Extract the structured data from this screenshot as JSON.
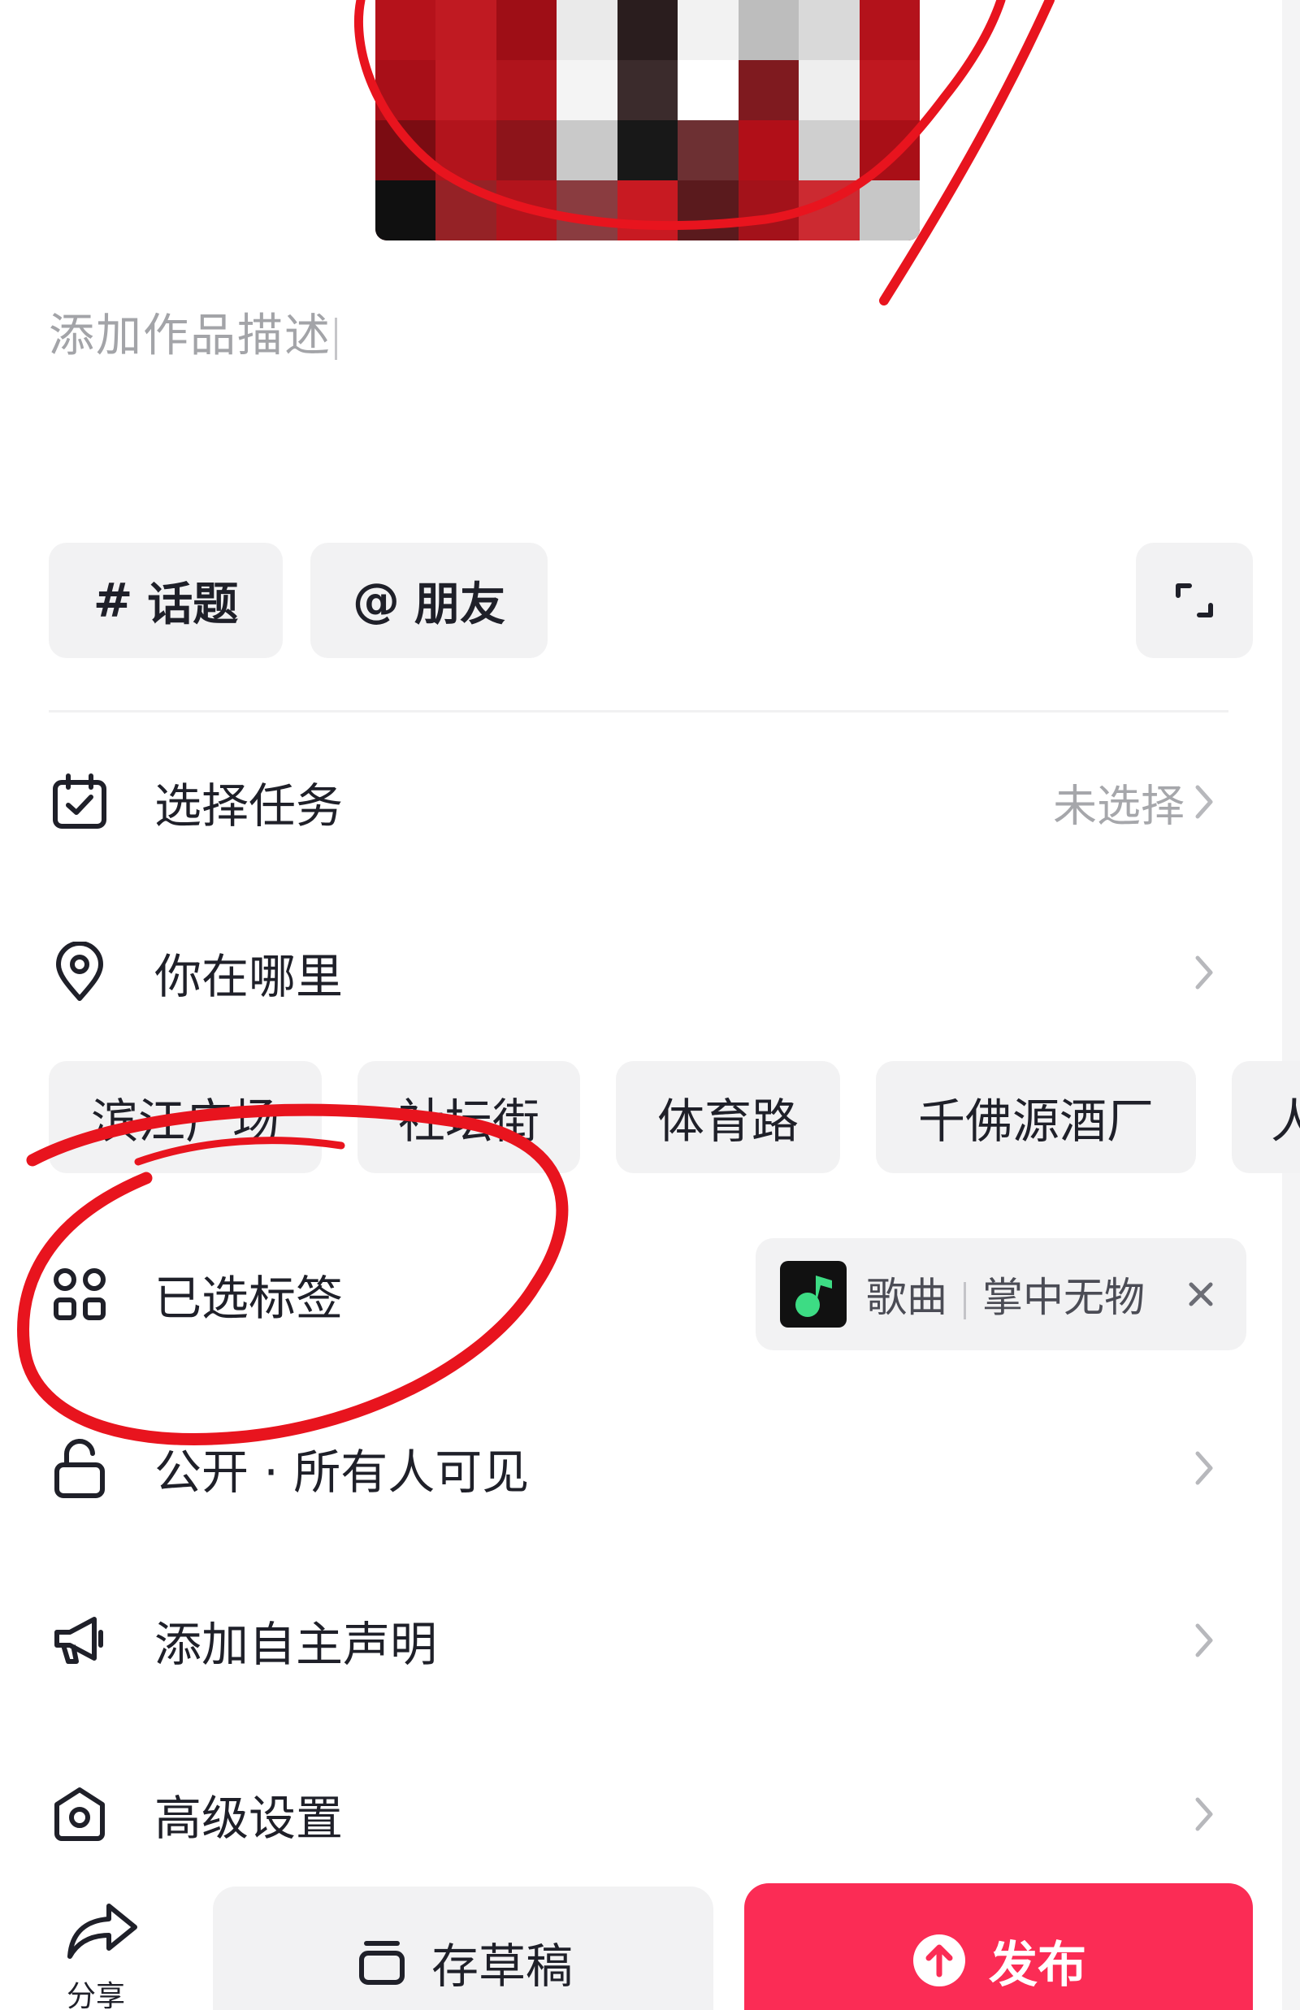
{
  "editor": {
    "description_placeholder": "添加作品描述"
  },
  "chips": {
    "topic": {
      "symbol": "#",
      "label": "话题"
    },
    "friend": {
      "symbol": "@",
      "label": "朋友"
    }
  },
  "rows": {
    "task": {
      "label": "选择任务",
      "value": "未选择"
    },
    "where": {
      "label": "你在哪里"
    },
    "tags": {
      "label": "已选标签"
    },
    "visibility": {
      "label": "公开 · 所有人可见"
    },
    "declaration": {
      "label": "添加自主声明"
    },
    "advanced": {
      "label": "高级设置"
    }
  },
  "location_suggestions": [
    "滨江广场",
    "社坛街",
    "体育路",
    "千佛源酒厂",
    "人"
  ],
  "selected_tag": {
    "type": "歌曲",
    "name": "掌中无物",
    "icon": "music-app-icon"
  },
  "bottom_bar": {
    "share_label": "分享",
    "draft_label": "存草稿",
    "publish_label": "发布"
  },
  "colors": {
    "accent": "#fb2c55",
    "annotation": "#e8141e",
    "chip_bg": "#f2f2f3",
    "muted_text": "#a6a7ab"
  }
}
